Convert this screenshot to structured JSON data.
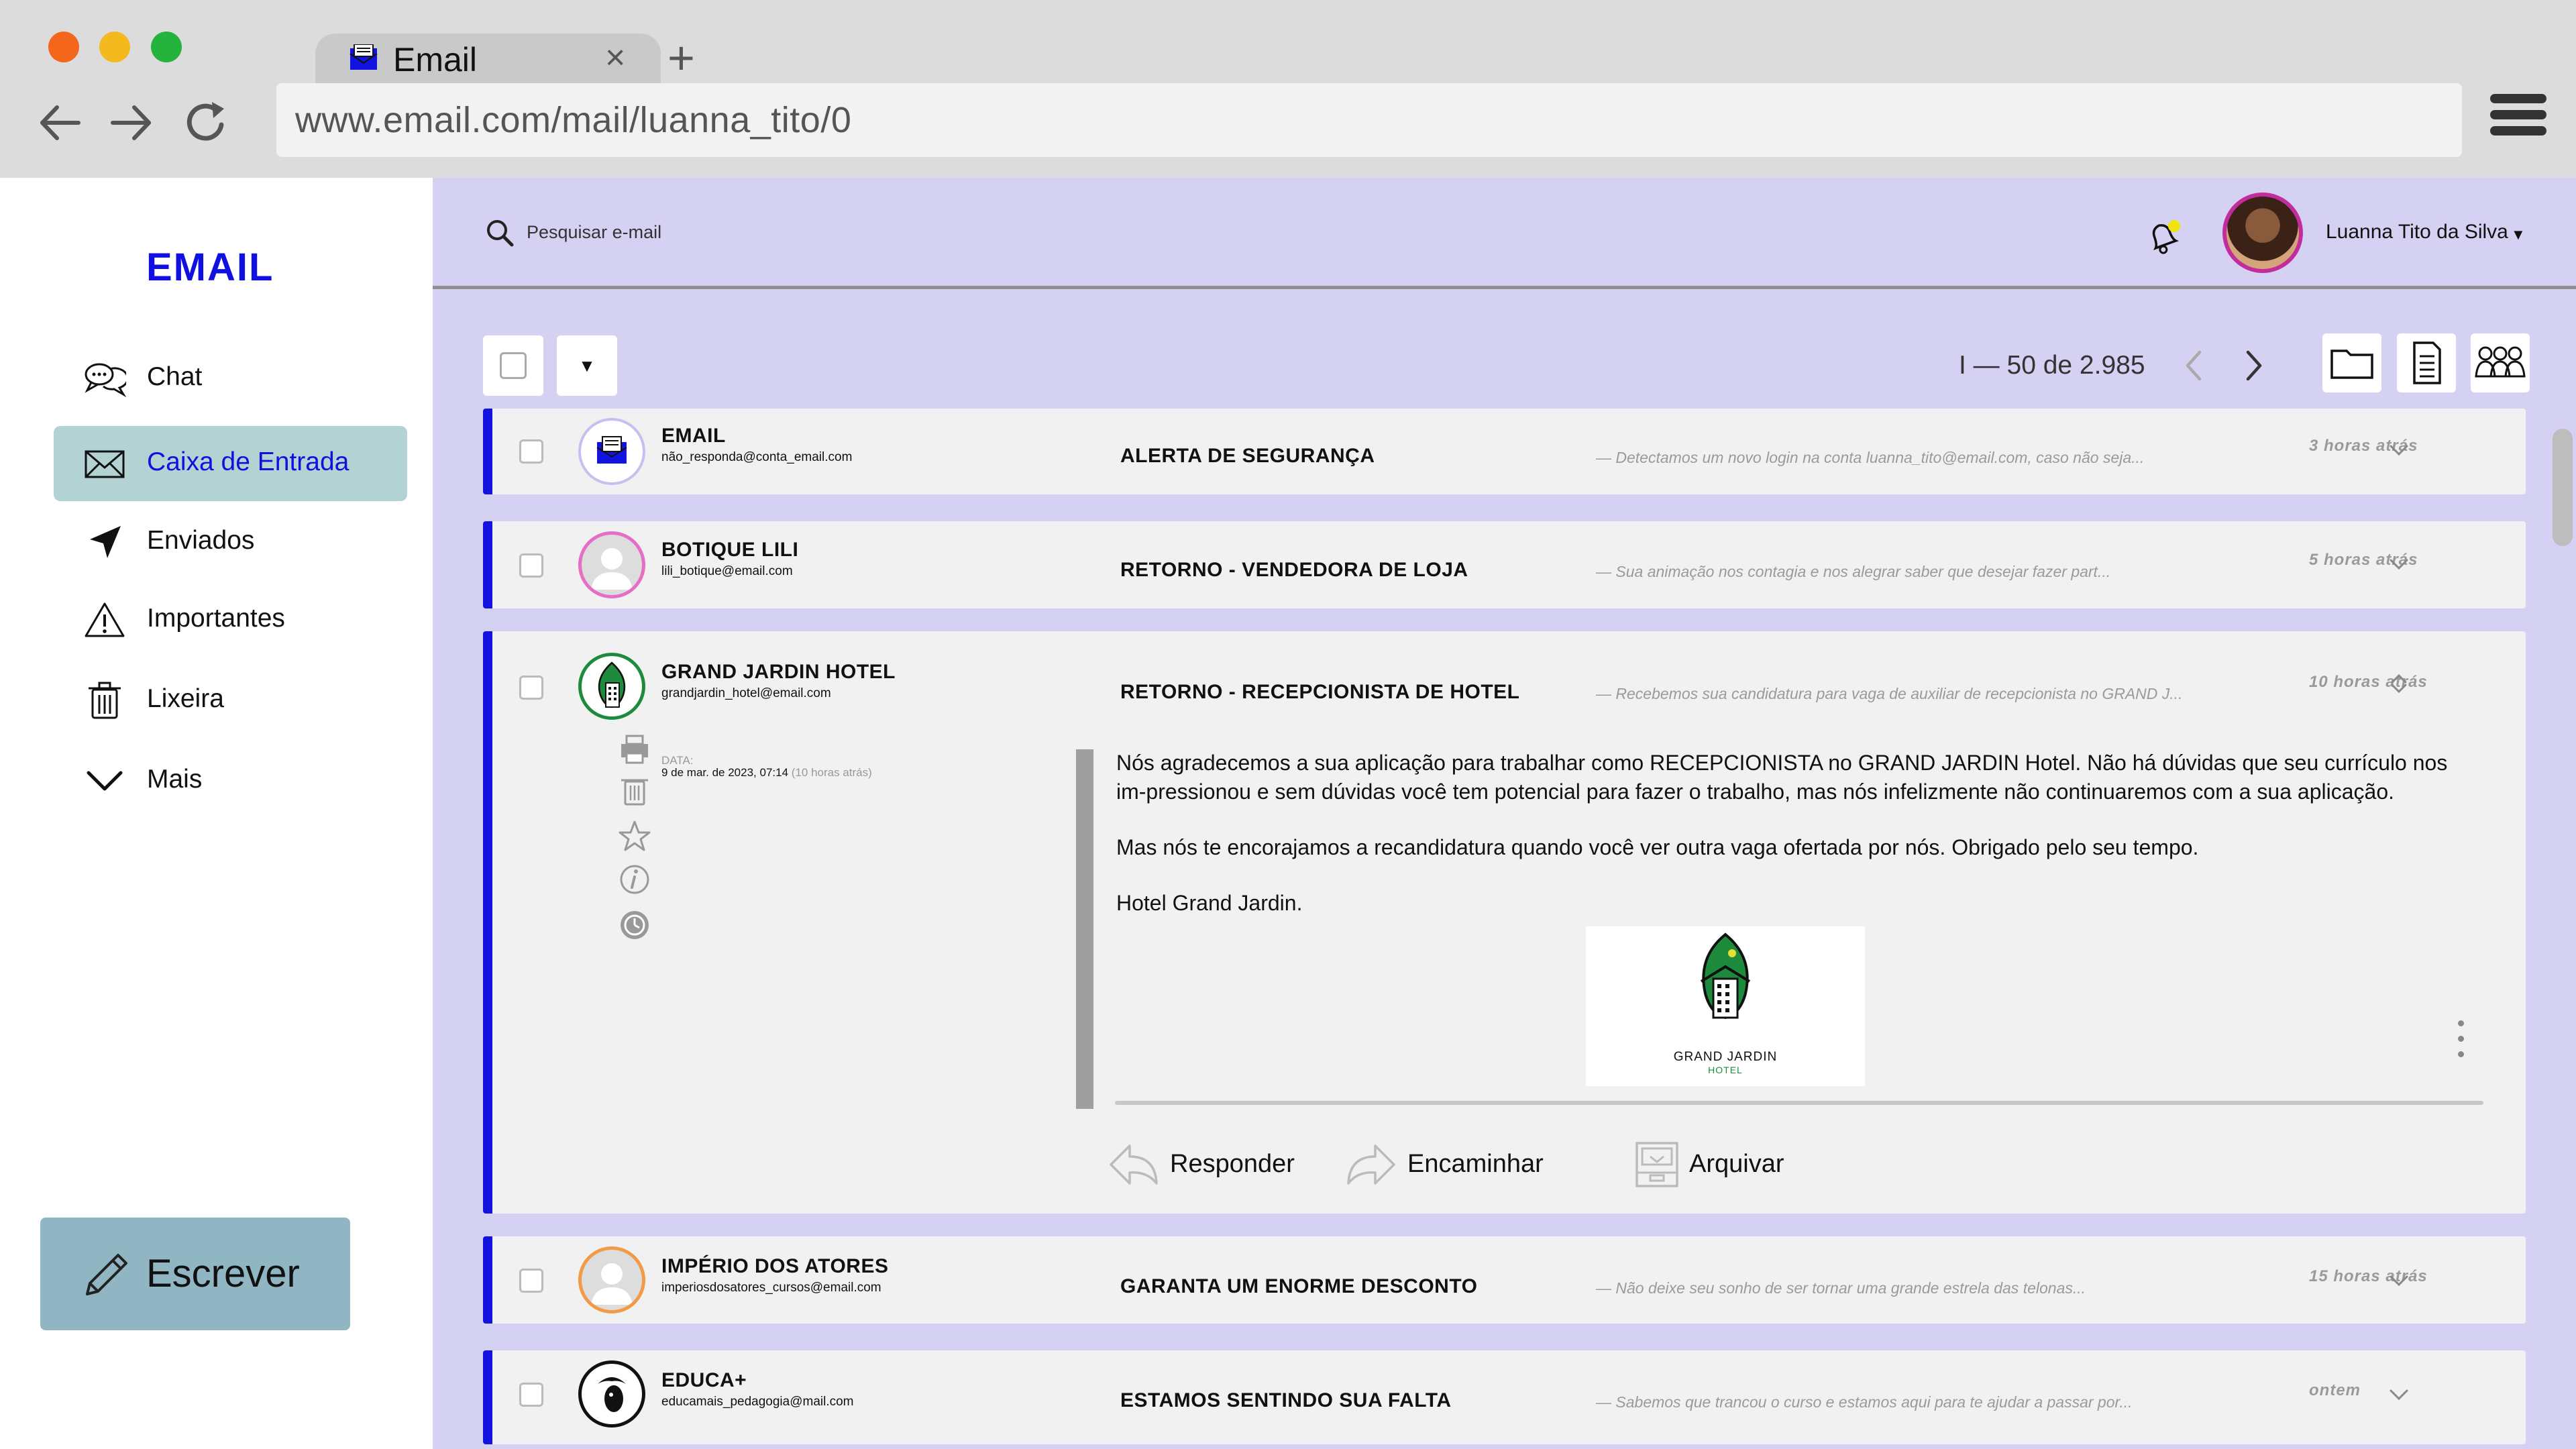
{
  "browser": {
    "tab_title": "Email",
    "tab_close": "×",
    "new_tab": "+",
    "url": "www.email.com/mail/luanna_tito/0"
  },
  "sidebar": {
    "brand": "EMAIL",
    "items": [
      {
        "label": "Chat",
        "icon": "chat-icon"
      },
      {
        "label": "Caixa de Entrada",
        "icon": "envelope-icon"
      },
      {
        "label": "Enviados",
        "icon": "send-icon"
      },
      {
        "label": "Importantes",
        "icon": "warning-icon"
      },
      {
        "label": "Lixeira",
        "icon": "trash-icon"
      },
      {
        "label": "Mais",
        "icon": "chevron-down-icon"
      }
    ],
    "compose_label": "Escrever"
  },
  "header": {
    "search_placeholder": "Pesquisar e-mail",
    "user_name": "Luanna Tito da Silva",
    "user_caret": "▼"
  },
  "toolbar": {
    "dropdown_symbol": "▼",
    "pagination": "I — 50 de 2.985"
  },
  "emails": [
    {
      "sender": "EMAIL",
      "sender_email": "não_responda@conta_email.com",
      "subject": "ALERTA DE SEGURANÇA",
      "snippet": "— Detectamos um novo login na conta luanna_tito@email.com, caso não seja...",
      "time": "3 horas atrás"
    },
    {
      "sender": "BOTIQUE LILI",
      "sender_email": "lili_botique@email.com",
      "subject": "RETORNO - VENDEDORA DE LOJA",
      "snippet": "— Sua animação nos contagia e nos alegrar saber que desejar fazer part...",
      "time": "5 horas atrás"
    },
    {
      "sender": "GRAND JARDIN HOTEL",
      "sender_email": "grandjardin_hotel@email.com",
      "subject": "RETORNO - RECEPCIONISTA DE HOTEL",
      "snippet": "— Recebemos sua candidatura para vaga de auxiliar de recepcionista no GRAND J...",
      "time": "10 horas atrás",
      "date_label": "DATA:",
      "date_value": "9 de mar. de 2023, 07:14",
      "date_relative": "(10 horas atrás)",
      "body": [
        "Nós agradecemos a sua aplicação para trabalhar como RECEPCIONISTA no GRAND JARDIN Hotel. Não há dúvidas que seu currículo nos im-pressionou e sem dúvidas você tem potencial para fazer o trabalho, mas nós infelizmente não continuaremos com a sua aplicação.",
        "Mas nós te encorajamos a recandidatura quando você ver outra vaga ofertada por nós. Obrigado pelo seu tempo.",
        "Hotel Grand Jardin."
      ],
      "logo_line1": "GRAND JARDIN",
      "logo_line2": "HOTEL",
      "actions": {
        "reply": "Responder",
        "forward": "Encaminhar",
        "archive": "Arquivar"
      }
    },
    {
      "sender": "IMPÉRIO DOS ATORES",
      "sender_email": "imperiosdosatores_cursos@email.com",
      "subject": "GARANTA UM ENORME DESCONTO",
      "snippet": "— Não deixe seu sonho de ser tornar uma grande estrela das telonas...",
      "time": "15 horas atrás"
    },
    {
      "sender": "EDUCA+",
      "sender_email": "educamais_pedagogia@mail.com",
      "subject": "ESTAMOS SENTINDO SUA FALTA",
      "snippet": "— Sabemos que trancou o curso e estamos aqui para te ajudar a passar por...",
      "time": "ontem"
    }
  ],
  "colors": {
    "accent_blue": "#1313e0",
    "main_bg": "#d4d1f2",
    "active_nav": "#b3d2d3",
    "compose_bg": "#90b6c3",
    "hotel_green": "#1e8a3c"
  }
}
